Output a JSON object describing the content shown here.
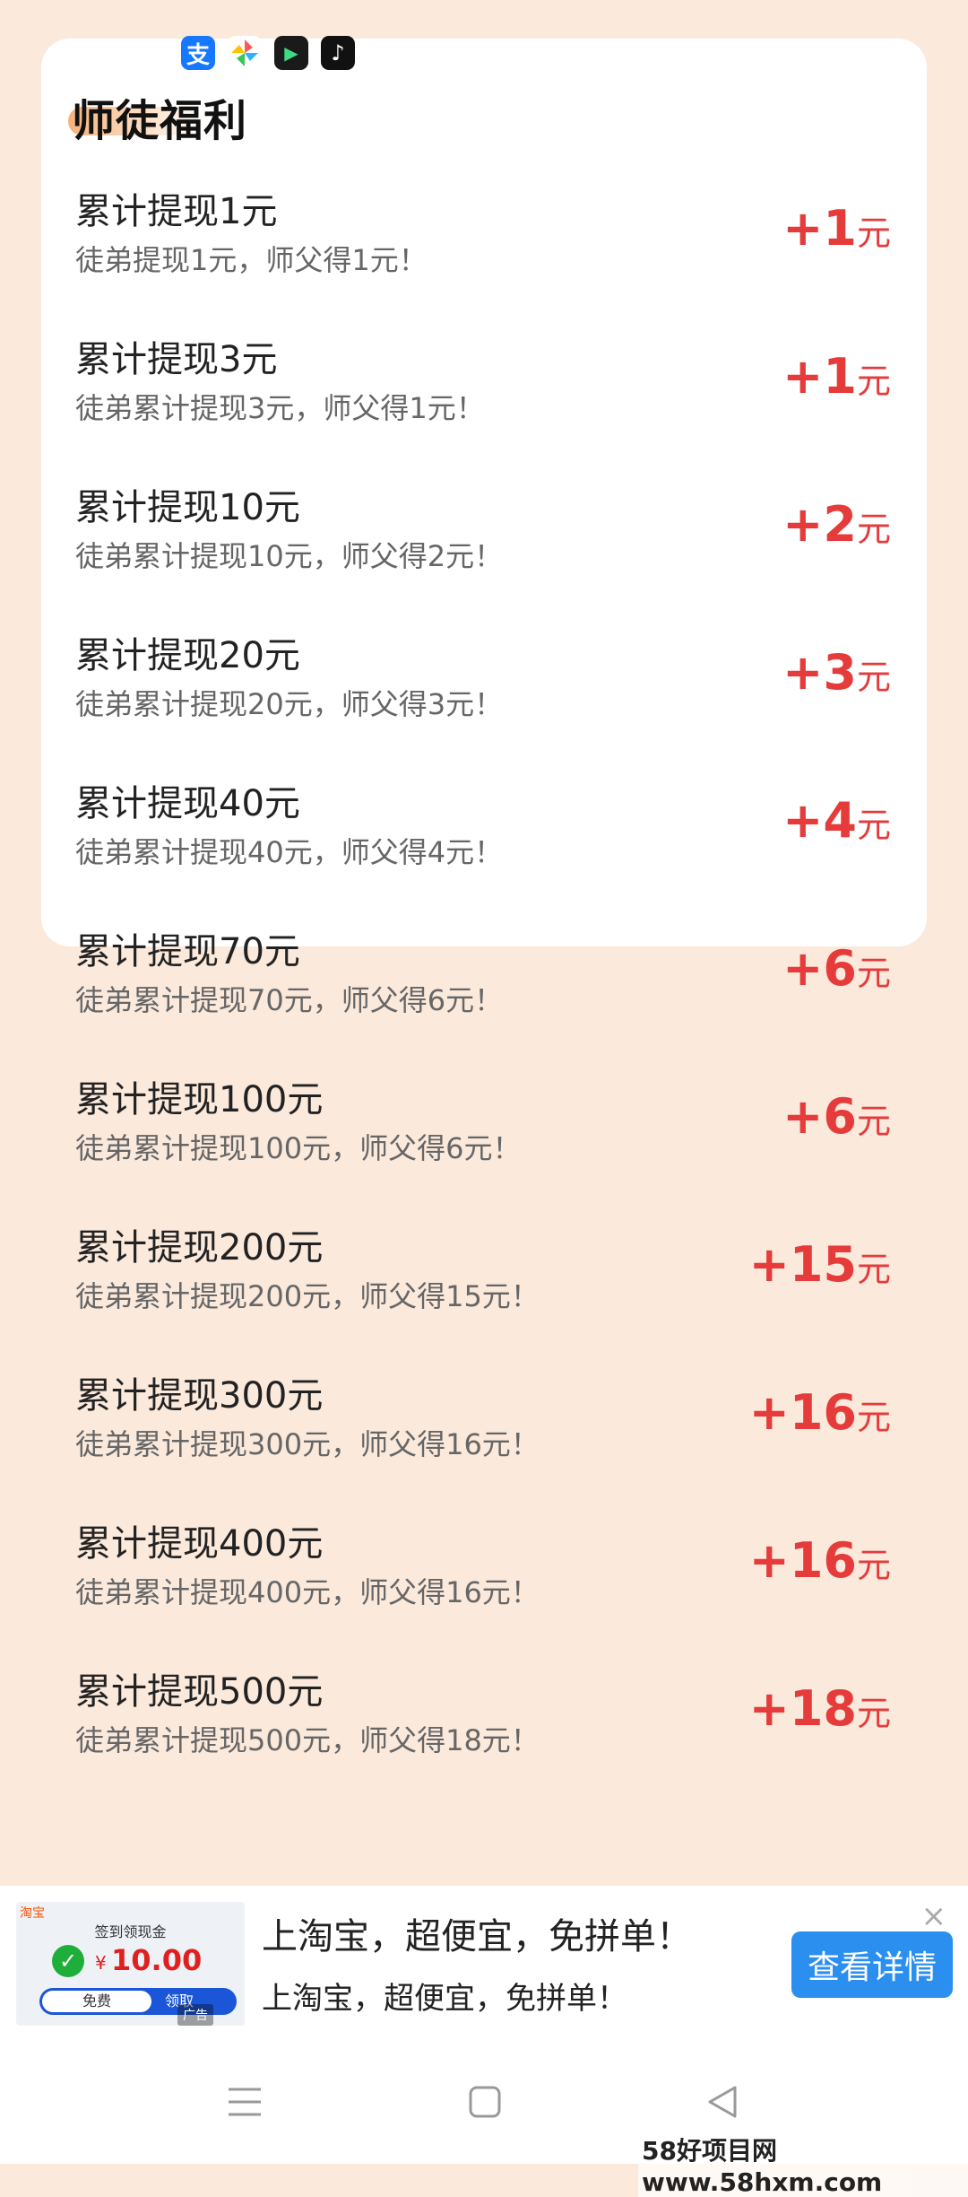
{
  "top_icons": [
    {
      "name": "alipay-icon",
      "glyph": "支"
    },
    {
      "name": "photos-icon",
      "glyph": ""
    },
    {
      "name": "video-app-icon",
      "glyph": "▶"
    },
    {
      "name": "tiktok-icon",
      "glyph": "♪"
    }
  ],
  "card": {
    "title": "师徒福利",
    "rows": [
      {
        "title": "累计提现1元",
        "desc": "徒弟提现1元，师父得1元！",
        "amount": "+1",
        "unit": "元"
      },
      {
        "title": "累计提现3元",
        "desc": "徒弟累计提现3元，师父得1元！",
        "amount": "+1",
        "unit": "元"
      },
      {
        "title": "累计提现10元",
        "desc": "徒弟累计提现10元，师父得2元！",
        "amount": "+2",
        "unit": "元"
      },
      {
        "title": "累计提现20元",
        "desc": "徒弟累计提现20元，师父得3元！",
        "amount": "+3",
        "unit": "元"
      },
      {
        "title": "累计提现40元",
        "desc": "徒弟累计提现40元，师父得4元！",
        "amount": "+4",
        "unit": "元"
      },
      {
        "title": "累计提现70元",
        "desc": "徒弟累计提现70元，师父得6元！",
        "amount": "+6",
        "unit": "元"
      },
      {
        "title": "累计提现100元",
        "desc": "徒弟累计提现100元，师父得6元！",
        "amount": "+6",
        "unit": "元"
      },
      {
        "title": "累计提现200元",
        "desc": "徒弟累计提现200元，师父得15元！",
        "amount": "+15",
        "unit": "元"
      },
      {
        "title": "累计提现300元",
        "desc": "徒弟累计提现300元，师父得16元！",
        "amount": "+16",
        "unit": "元"
      },
      {
        "title": "累计提现400元",
        "desc": "徒弟累计提现400元，师父得16元！",
        "amount": "+16",
        "unit": "元"
      },
      {
        "title": "累计提现500元",
        "desc": "徒弟累计提现500元，师父得18元！",
        "amount": "+18",
        "unit": "元"
      }
    ]
  },
  "ad": {
    "thumb_brand": "淘宝",
    "thumb_title": "签到领现金",
    "thumb_currency": "¥",
    "thumb_amount": "10.00",
    "thumb_free": "免费",
    "thumb_claim": "领取",
    "tag": "广告",
    "headline": "上淘宝，超便宜，免拼单！",
    "subline": "上淘宝，超便宜，免拼单！",
    "button": "查看详情",
    "close": "×"
  },
  "watermark": "58好项目网www.58hxm.com",
  "colors": {
    "background": "#fbe9dc",
    "reward_red": "#e53b3b",
    "ad_button": "#2b8ff0"
  }
}
